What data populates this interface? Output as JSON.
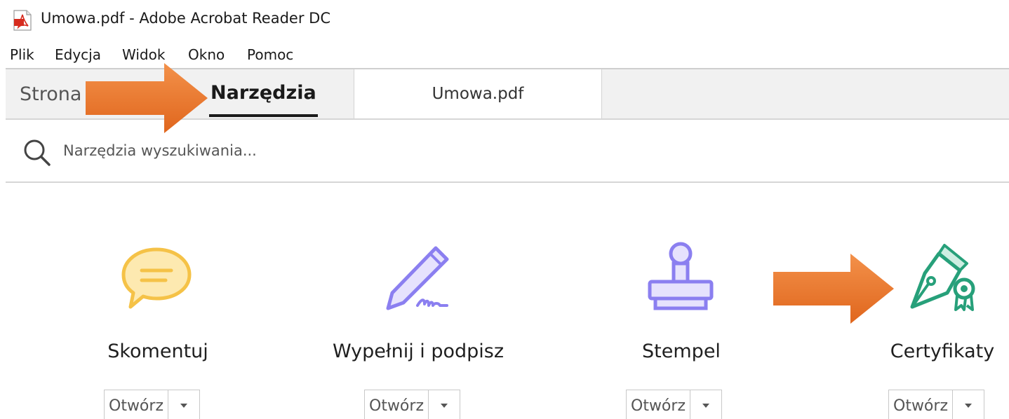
{
  "window": {
    "title": "Umowa.pdf - Adobe Acrobat Reader DC"
  },
  "menu": {
    "items": [
      "Plik",
      "Edycja",
      "Widok",
      "Okno",
      "Pomoc"
    ]
  },
  "tabs": {
    "home": "Strona",
    "tools": "Narzędzia",
    "document": "Umowa.pdf"
  },
  "search": {
    "placeholder": "Narzędzia wyszukiwania..."
  },
  "tools": [
    {
      "label": "Skomentuj",
      "icon": "comment-bubble-icon",
      "open_label": "Otwórz",
      "color": "#f5c247"
    },
    {
      "label": "Wypełnij i podpisz",
      "icon": "pen-sign-icon",
      "open_label": "Otwórz",
      "color": "#8b7ff0"
    },
    {
      "label": "Stempel",
      "icon": "stamp-icon",
      "open_label": "Otwórz",
      "color": "#8b7ff0"
    },
    {
      "label": "Certyfikaty",
      "icon": "certificate-pen-icon",
      "open_label": "Otwórz",
      "color": "#27a07a"
    }
  ],
  "colors": {
    "arrow": "#ea7426",
    "tab_bar": "#f1f1f1"
  }
}
